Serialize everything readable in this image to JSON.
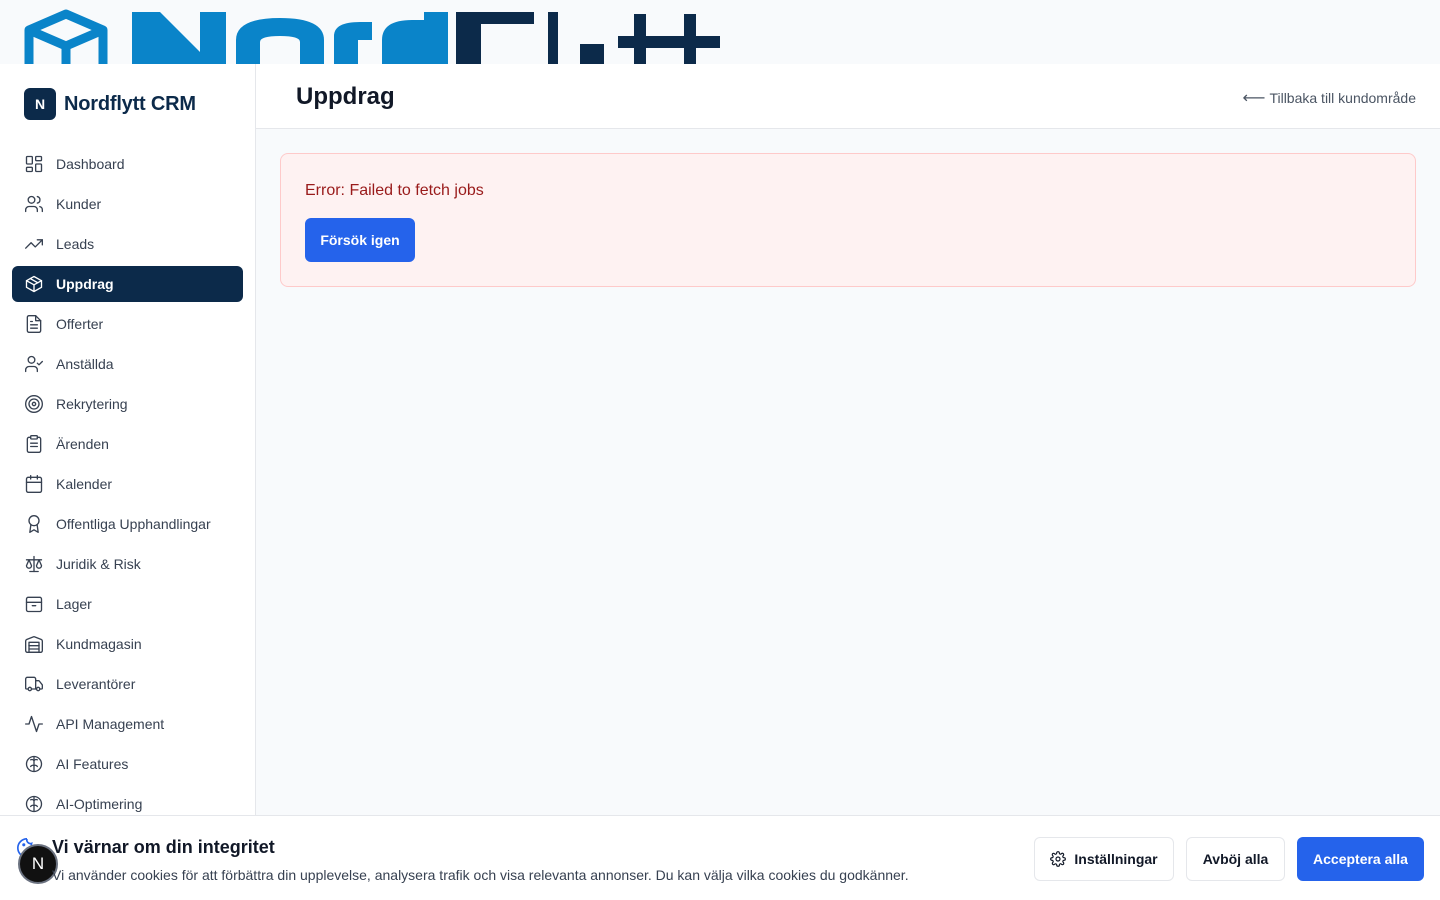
{
  "brand": {
    "mark": "N",
    "name": "Nordflytt CRM"
  },
  "nav": [
    {
      "label": "Dashboard",
      "icon": "dashboard-icon"
    },
    {
      "label": "Kunder",
      "icon": "users-icon"
    },
    {
      "label": "Leads",
      "icon": "trending-up-icon"
    },
    {
      "label": "Uppdrag",
      "icon": "package-icon",
      "active": true
    },
    {
      "label": "Offerter",
      "icon": "file-text-icon"
    },
    {
      "label": "Anställda",
      "icon": "user-check-icon"
    },
    {
      "label": "Rekrytering",
      "icon": "target-icon"
    },
    {
      "label": "Ärenden",
      "icon": "clipboard-icon"
    },
    {
      "label": "Kalender",
      "icon": "calendar-icon"
    },
    {
      "label": "Offentliga Upphandlingar",
      "icon": "award-icon"
    },
    {
      "label": "Juridik & Risk",
      "icon": "scale-icon"
    },
    {
      "label": "Lager",
      "icon": "box-icon"
    },
    {
      "label": "Kundmagasin",
      "icon": "warehouse-icon"
    },
    {
      "label": "Leverantörer",
      "icon": "truck-icon"
    },
    {
      "label": "API Management",
      "icon": "activity-icon"
    },
    {
      "label": "AI Features",
      "icon": "brain-icon"
    },
    {
      "label": "AI-Optimering",
      "icon": "brain-icon"
    }
  ],
  "header": {
    "title": "Uppdrag",
    "back_link": "Tillbaka till kundområde",
    "back_arrow": "⟵"
  },
  "error": {
    "message": "Error: Failed to fetch jobs",
    "retry_label": "Försök igen"
  },
  "cookie": {
    "title": "Vi värnar om din integritet",
    "description": "Vi använder cookies för att förbättra din upplevelse, analysera trafik och visa relevanta annonser. Du kan välja vilka cookies du godkänner.",
    "settings_label": "Inställningar",
    "reject_label": "Avböj alla",
    "accept_label": "Acceptera alla",
    "badge": "N"
  },
  "colors": {
    "primary": "#0c2a4a",
    "accent": "#2563eb",
    "error_bg": "#fef2f2",
    "error_text": "#991b1b",
    "logo_blue": "#0a84c9"
  }
}
